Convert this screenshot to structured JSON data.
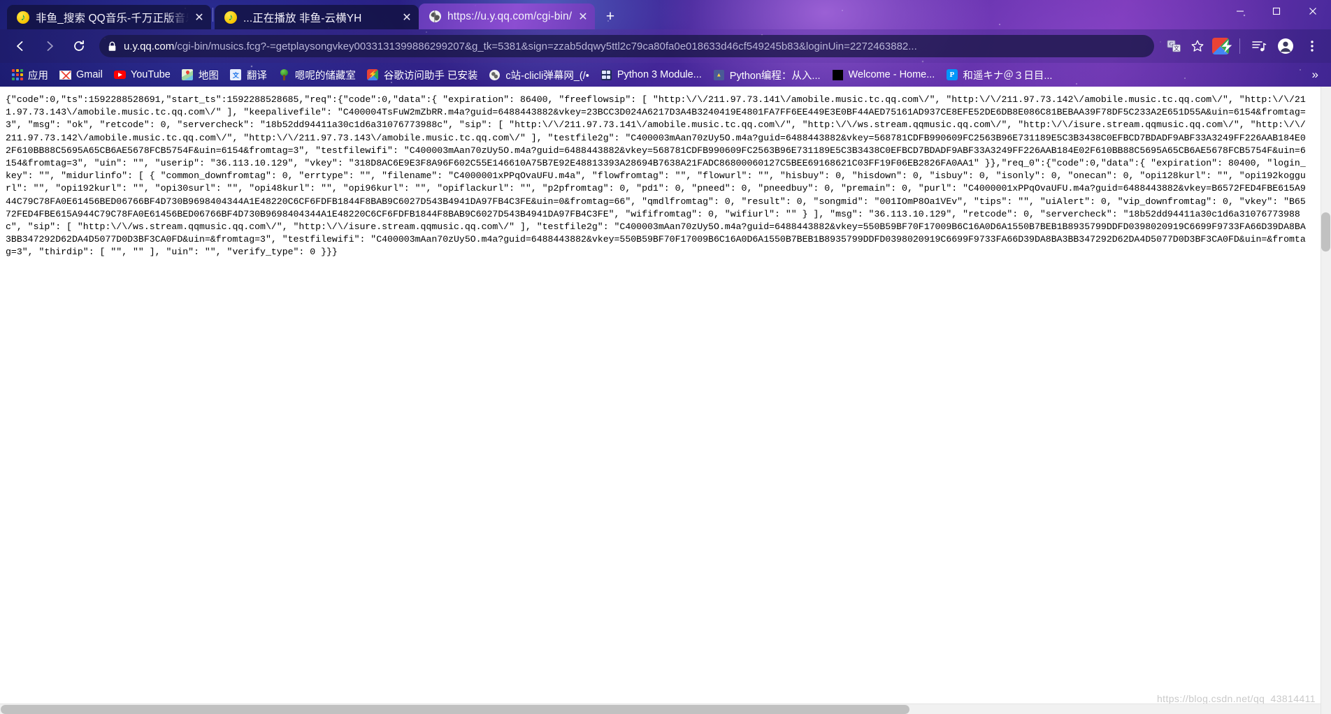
{
  "window": {
    "minimize_label": "—",
    "maximize_label": "☐",
    "close_label": "✕"
  },
  "tabs": [
    {
      "title": "非鱼_搜索 QQ音乐-千万正版音乐",
      "favicon": "qq-music-icon",
      "active": false,
      "close_label": "✕"
    },
    {
      "title": "...正在播放 非鱼-云横YH",
      "favicon": "qq-music-icon",
      "active": false,
      "close_label": "✕"
    },
    {
      "title": "https://u.y.qq.com/cgi-bin/mu",
      "favicon": "globe-icon",
      "active": true,
      "close_label": "✕"
    }
  ],
  "new_tab_label": "+",
  "toolbar": {
    "back_label": "←",
    "forward_label": "→",
    "reload_label": "⟳",
    "lock_icon": "lock-icon",
    "url_host": "u.y.qq.com",
    "url_path": "/cgi-bin/musics.fcg?-=getplaysongvkey0033131399886299207&g_tk=5381&sign=zzab5dqwy5ttl2c79ca80fa0e018633d46cf549245b83&loginUin=2272463882...",
    "translate_icon": "translate-icon",
    "bookmark_star_icon": "star-icon",
    "extension_icon": "google-access-assistant-icon",
    "reading_list_icon": "reading-list-icon",
    "profile_icon": "profile-avatar-icon",
    "menu_icon": "three-dot-menu-icon"
  },
  "bookmarks": {
    "items": [
      {
        "label": "应用",
        "icon": "apps-grid-icon"
      },
      {
        "label": "Gmail",
        "icon": "gmail-icon"
      },
      {
        "label": "YouTube",
        "icon": "youtube-icon"
      },
      {
        "label": "地图",
        "icon": "google-maps-icon"
      },
      {
        "label": "翻译",
        "icon": "google-translate-icon"
      },
      {
        "label": "嗯呢的储藏室",
        "icon": "tree-icon"
      },
      {
        "label": "谷歌访问助手 已安装",
        "icon": "google-access-assistant-icon"
      },
      {
        "label": "c站-clicli弹幕网_(/•",
        "icon": "globe-icon"
      },
      {
        "label": "Python 3 Module...",
        "icon": "grid-blue-icon"
      },
      {
        "label": "Python编程：从入...",
        "icon": "python-book-icon"
      },
      {
        "label": "Welcome - Home...",
        "icon": "black-square-icon"
      },
      {
        "label": "和遥キナ＠３日目...",
        "icon": "pixiv-icon"
      }
    ],
    "overflow_label": "»"
  },
  "page": {
    "json_response": "{\"code\":0,\"ts\":1592288528691,\"start_ts\":1592288528685,\"req\":{\"code\":0,\"data\":{ \"expiration\": 86400, \"freeflowsip\": [ \"http:\\/\\/211.97.73.141\\/amobile.music.tc.qq.com\\/\", \"http:\\/\\/211.97.73.142\\/amobile.music.tc.qq.com\\/\", \"http:\\/\\/211.97.73.143\\/amobile.music.tc.qq.com\\/\" ], \"keepalivefile\": \"C400004TsFuW2mZbRR.m4a?guid=6488443882&vkey=23BCC3D024A6217D3A4B3240419E4801FA7FF6EE449E3E0BF44AED75161AD937CE8EFE52DE6DB8E086C81BEBAA39F78DF5C233A2E651D55A&uin=6154&fromtag=3\", \"msg\": \"ok\", \"retcode\": 0, \"servercheck\": \"18b52dd94411a30c1d6a31076773988c\", \"sip\": [ \"http:\\/\\/211.97.73.141\\/amobile.music.tc.qq.com\\/\", \"http:\\/\\/ws.stream.qqmusic.qq.com\\/\", \"http:\\/\\/isure.stream.qqmusic.qq.com\\/\", \"http:\\/\\/211.97.73.142\\/amobile.music.tc.qq.com\\/\", \"http:\\/\\/211.97.73.143\\/amobile.music.tc.qq.com\\/\" ], \"testfile2g\": \"C400003mAan70zUy5O.m4a?guid=6488443882&vkey=568781CDFB990609FC2563B96E731189E5C3B3438C0EFBCD7BDADF9ABF33A3249FF226AAB184E02F610BB88C5695A65CB6AE5678FCB5754F&uin=6154&fromtag=3\", \"testfilewifi\": \"C400003mAan70zUy5O.m4a?guid=6488443882&vkey=568781CDFB990609FC2563B96E731189E5C3B3438C0EFBCD7BDADF9ABF33A3249FF226AAB184E02F610BB88C5695A65CB6AE5678FCB5754F&uin=6154&fromtag=3\", \"uin\": \"\", \"userip\": \"36.113.10.129\", \"vkey\": \"318D8AC6E9E3F8A96F602C55E146610A75B7E92E48813393A28694B7638A21FADC86800060127C5BEE69168621C03FF19F06EB2826FA0AA1\" }},\"req_0\":{\"code\":0,\"data\":{ \"expiration\": 80400, \"login_key\": \"\", \"midurlinfo\": [ { \"common_downfromtag\": 0, \"errtype\": \"\", \"filename\": \"C4000001xPPqOvaUFU.m4a\", \"flowfromtag\": \"\", \"flowurl\": \"\", \"hisbuy\": 0, \"hisdown\": 0, \"isbuy\": 0, \"isonly\": 0, \"onecan\": 0, \"opi128kurl\": \"\", \"opi192koggurl\": \"\", \"opi192kurl\": \"\", \"opi30surl\": \"\", \"opi48kurl\": \"\", \"opi96kurl\": \"\", \"opiflackurl\": \"\", \"p2pfromtag\": 0, \"pd1\": 0, \"pneed\": 0, \"pneedbuy\": 0, \"premain\": 0, \"purl\": \"C4000001xPPqOvaUFU.m4a?guid=6488443882&vkey=B6572FED4FBE615A944C79C78FA0E61456BED06766BF4D730B9698404344A1E48220C6CF6FDFB1844F8BAB9C6027D543B4941DA97FB4C3FE&uin=0&fromtag=66\", \"qmdlfromtag\": 0, \"result\": 0, \"songmid\": \"001IOmP8Oa1VEv\", \"tips\": \"\", \"uiAlert\": 0, \"vip_downfromtag\": 0, \"vkey\": \"B6572FED4FBE615A944C79C78FA0E61456BED06766BF4D730B9698404344A1E48220C6CF6FDFB1844F8BAB9C6027D543B4941DA97FB4C3FE\", \"wififromtag\": 0, \"wifiurl\": \"\" } ], \"msg\": \"36.113.10.129\", \"retcode\": 0, \"servercheck\": \"18b52dd94411a30c1d6a31076773988c\", \"sip\": [ \"http:\\/\\/ws.stream.qqmusic.qq.com\\/\", \"http:\\/\\/isure.stream.qqmusic.qq.com\\/\" ], \"testfile2g\": \"C400003mAan70zUy5O.m4a?guid=6488443882&vkey=550B59BF70F17009B6C16A0D6A1550B7BEB1B8935799DDFD0398020919C6699F9733FA66D39DA8BA3BB347292D62DA4D5077D0D3BF3CA0FD&uin=&fromtag=3\", \"testfilewifi\": \"C400003mAan70zUy5O.m4a?guid=6488443882&vkey=550B59BF70F17009B6C16A0D6A1550B7BEB1B8935799DDFD0398020919C6699F9733FA66D39DA8BA3BB347292D62DA4D5077D0D3BF3CA0FD&uin=&fromtag=3\", \"thirdip\": [ \"\", \"\" ], \"uin\": \"\", \"verify_type\": 0 }}}",
    "watermark": "https://blog.csdn.net/qq_43814411"
  }
}
